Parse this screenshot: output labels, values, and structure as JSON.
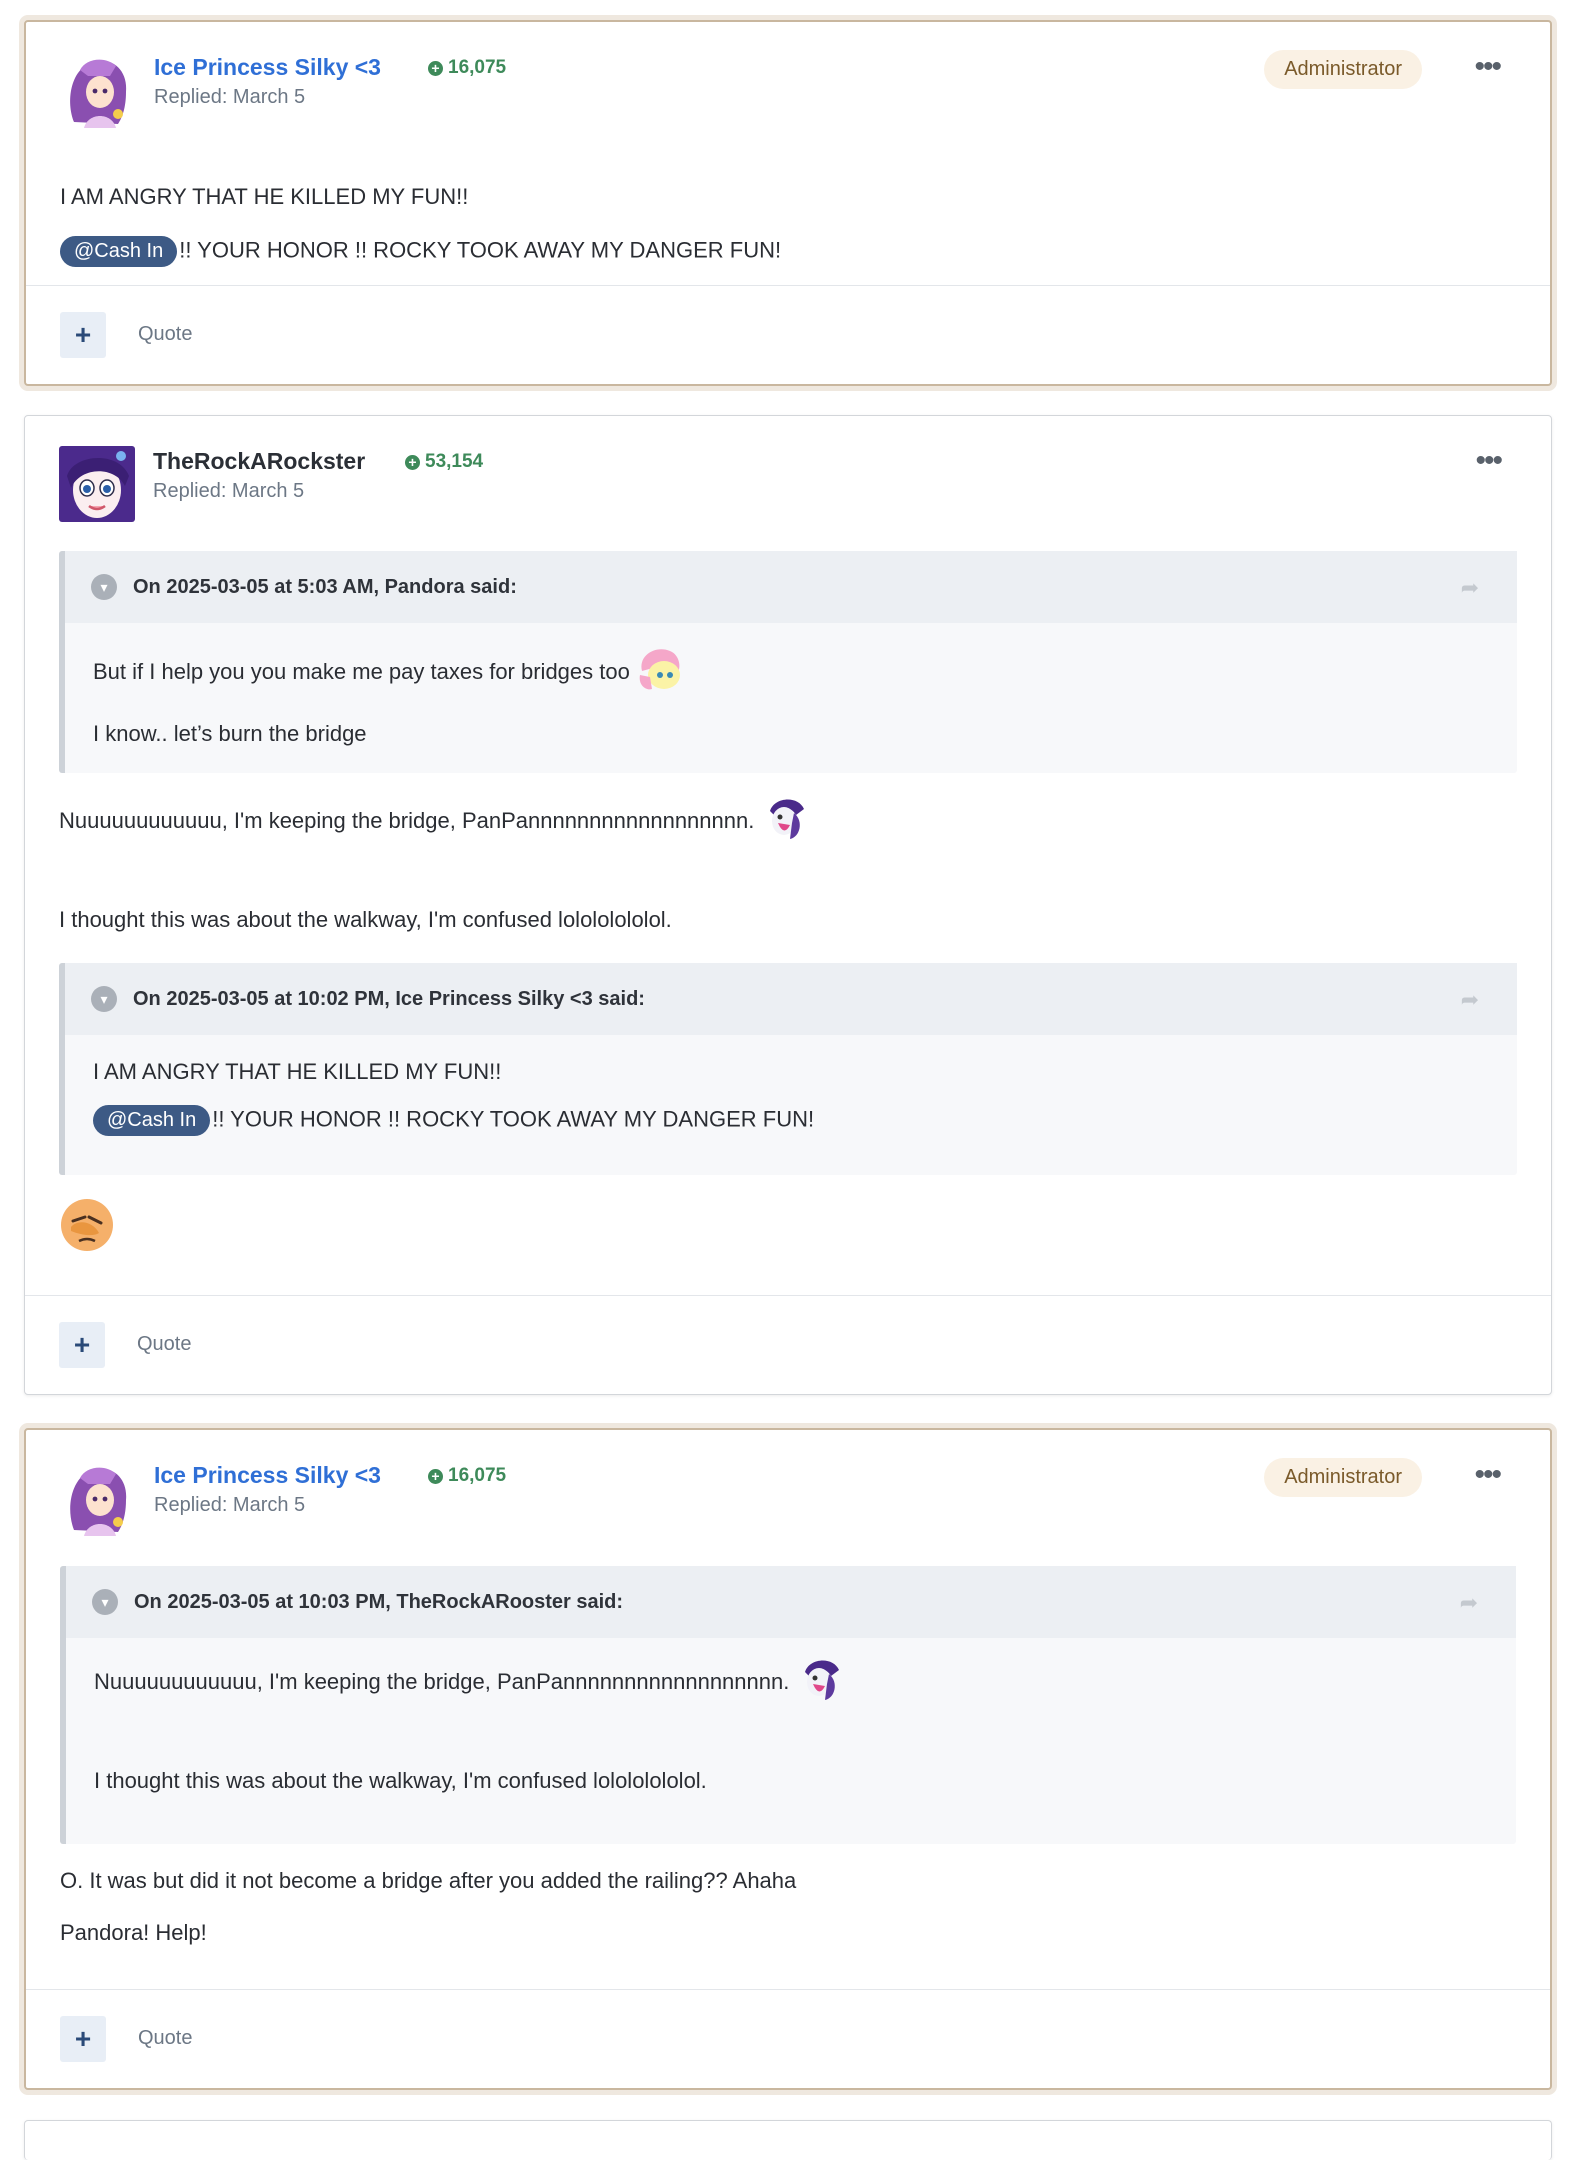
{
  "posts": [
    {
      "author": "Ice Princess Silky <3",
      "reputation": "16,075",
      "replied": "Replied: March 5",
      "badge": "Administrator",
      "lines": [
        "I AM ANGRY THAT HE KILLED MY FUN!!"
      ],
      "mention": "@Cash In",
      "mention_text": "!! YOUR HONOR !! ROCKY TOOK AWAY MY DANGER FUN!",
      "quote_label": "Quote"
    },
    {
      "author": "TheRockARockster",
      "reputation": "53,154",
      "replied": "Replied: March 5",
      "quote1": {
        "header": "On 2025-03-05 at 5:03 AM, Pandora said:",
        "line1": "But if I help you you make me pay taxes for bridges too",
        "line2": "I know.. let’s burn the bridge"
      },
      "line1": "Nuuuuuuuuuuuu, I'm keeping the bridge, PanPannnnnnnnnnnnnnnnnn.",
      "line2": "I thought this was about the walkway, I'm confused lolololololol.",
      "quote2": {
        "header": "On 2025-03-05 at 10:02 PM, Ice Princess Silky <3 said:",
        "line1": "I AM ANGRY THAT HE KILLED MY FUN!!",
        "mention": "@Cash In",
        "mention_text": "!! YOUR HONOR !! ROCKY TOOK AWAY MY DANGER FUN!"
      },
      "quote_label": "Quote"
    },
    {
      "author": "Ice Princess Silky <3",
      "reputation": "16,075",
      "replied": "Replied: March 5",
      "badge": "Administrator",
      "quote1": {
        "header": "On 2025-03-05 at 10:03 PM, TheRockARooster said:",
        "line1": "Nuuuuuuuuuuuu, I'm keeping the bridge, PanPannnnnnnnnnnnnnnnnn.",
        "line2": "I thought this was about the walkway, I'm confused lolololololol."
      },
      "line1": "O. It was but did it not become a bridge after you added the railing?? Ahaha",
      "line2": "Pandora! Help!",
      "quote_label": "Quote"
    }
  ],
  "icons": {
    "reputation": "plus-circle-icon",
    "more": "ellipsis-icon",
    "toggle": "chevron-down-icon",
    "share": "share-arrow-icon",
    "react": "plus-icon"
  }
}
